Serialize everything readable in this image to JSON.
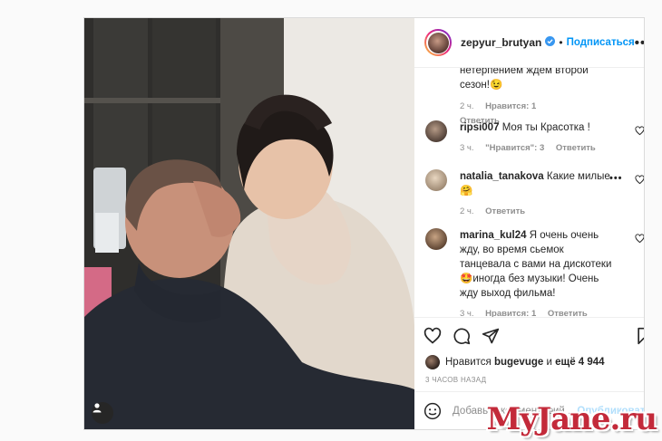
{
  "header": {
    "username": "zepyur_brutyan",
    "separator": "•",
    "follow_label": "Подписаться",
    "more_label": "•••"
  },
  "comment_fragment": {
    "text": "нетерпением ждем второй сезон!😉",
    "time": "2 ч.",
    "likes": "Нравится: 1",
    "reply": "Ответить"
  },
  "comments": [
    {
      "user": "ripsi007",
      "text": "Моя ты Красотка !",
      "time": "3 ч.",
      "likes": "\"Нравится\": 3",
      "reply": "Ответить",
      "avatar_color": "#7a6a5c"
    },
    {
      "user": "natalia_tanakova",
      "text": "Какие милые 🤗",
      "time": "2 ч.",
      "likes": "",
      "reply": "Ответить",
      "avatar_color": "#c9b59e"
    },
    {
      "user": "marina_kul24",
      "text": "Я очень очень жду, во время сьемок танцевала с вами на дискотеки 🤩иногда без музыки! Очень жду выход фильма!",
      "time": "3 ч.",
      "likes": "Нравится: 1",
      "reply": "Ответить",
      "avatar_color": "#8a6c52"
    }
  ],
  "likes_line": {
    "prefix": "Нравится",
    "user": "bugevuge",
    "middle": "и",
    "count": "ещё 4 944"
  },
  "timestamp": "3 ЧАСОВ НАЗАД",
  "add_comment": {
    "placeholder": "Добавьте комментарий...",
    "publish_label": "Опубликовать"
  },
  "watermark": "MyJane.ru",
  "colors": {
    "accent": "#0095f6",
    "watermark": "#c32a3a"
  },
  "icons": [
    "user-tag-icon",
    "verified-icon",
    "heart-icon",
    "comment-icon",
    "share-icon",
    "bookmark-icon",
    "emoji-icon"
  ]
}
